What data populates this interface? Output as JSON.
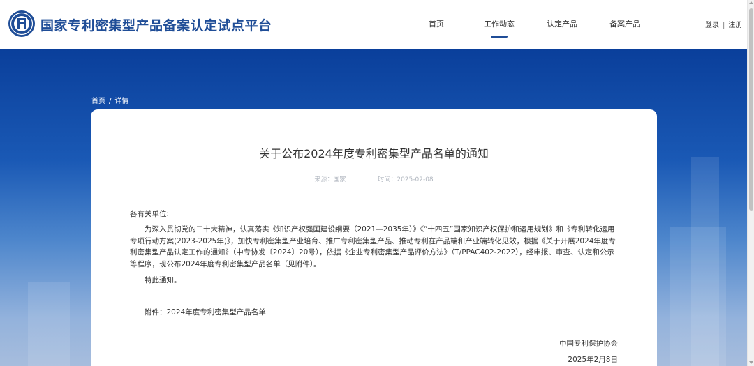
{
  "header": {
    "site_title": "国家专利密集型产品备案认定试点平台",
    "logo_icon": "emblem-icon",
    "nav": [
      {
        "label": "首页"
      },
      {
        "label": "工作动态"
      },
      {
        "label": "认定产品"
      },
      {
        "label": "备案产品"
      }
    ],
    "active_nav": "工作动态",
    "login_label": "登录",
    "auth_separator": "|",
    "register_label": "注册"
  },
  "breadcrumb": {
    "home": "首页",
    "separator": "/",
    "current": "详情"
  },
  "article": {
    "title": "关于公布2024年度专利密集型产品名单的通知",
    "source_label": "来源：国家",
    "time_label": "时间：2025-02-08",
    "salutation": "各有关单位:",
    "paragraph": "为深入贯彻党的二十大精神，认真落实《知识产权强国建设纲要（2021—2035年）》《“十四五”国家知识产权保护和运用规划》和《专利转化运用专项行动方案(2023-2025年)》，加快专利密集型产业培育、推广专利密集型产品、推动专利在产品端和产业端转化见效，根据《关于开展2024年度专利密集型产品认定工作的通知》（中专协发〔2024〕20号），依据《企业专利密集型产品评价方法》（T/PPAC402-2022），经申报、审查、认定和公示等程序，现公布2024年度专利密集型产品名单（见附件）。",
    "notice": "特此通知。",
    "attachment": "附件：2024年度专利密集型产品名单",
    "signer": "中国专利保护协会",
    "sign_date": "2025年2月8日"
  },
  "colors": {
    "brand_blue": "#1f4d97",
    "banner_top": "#0a3f9b",
    "banner_bottom": "#a7bddd"
  }
}
